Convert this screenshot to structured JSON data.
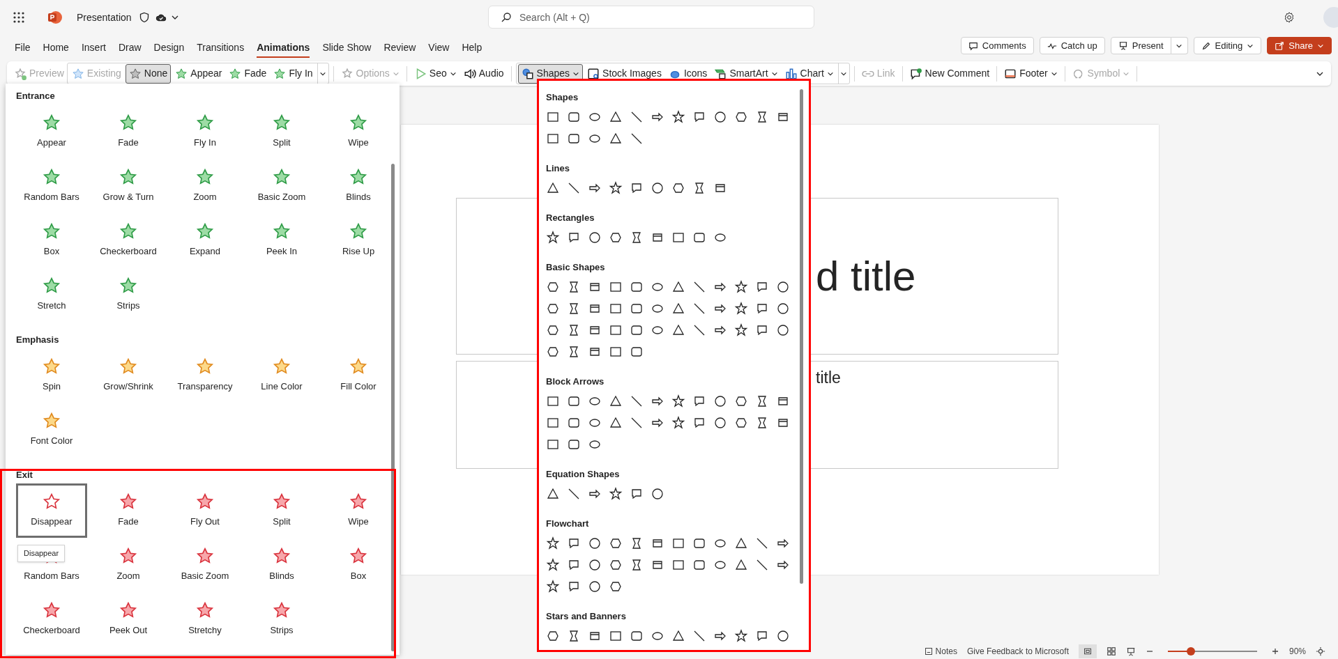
{
  "app": {
    "title": "Presentation"
  },
  "search": {
    "placeholder": "Search (Alt + Q)"
  },
  "menu_tabs": [
    {
      "label": "File",
      "selected": false
    },
    {
      "label": "Home",
      "selected": false
    },
    {
      "label": "Insert",
      "selected": false
    },
    {
      "label": "Draw",
      "selected": false
    },
    {
      "label": "Design",
      "selected": false
    },
    {
      "label": "Transitions",
      "selected": false
    },
    {
      "label": "Animations",
      "selected": true
    },
    {
      "label": "Slide Show",
      "selected": false
    },
    {
      "label": "Review",
      "selected": false
    },
    {
      "label": "View",
      "selected": false
    },
    {
      "label": "Help",
      "selected": false
    }
  ],
  "header_buttons": [
    {
      "label": "Comments",
      "kind": "comments"
    },
    {
      "label": "Catch up",
      "kind": "catchup"
    },
    {
      "label": "Present",
      "kind": "present"
    },
    {
      "label": "Editing",
      "kind": "editing"
    },
    {
      "label": "Share",
      "kind": "share"
    }
  ],
  "ribbon": [
    [
      {
        "label": "Preview",
        "disabled": true,
        "dropdown": false,
        "selected": false
      }
    ],
    [
      {
        "label": "Existing",
        "disabled": true,
        "dropdown": false,
        "selected": false
      },
      {
        "label": "None",
        "disabled": false,
        "dropdown": false,
        "selected": true
      },
      {
        "label": "Appear",
        "disabled": false,
        "dropdown": false,
        "selected": false
      },
      {
        "label": "Fade",
        "disabled": false,
        "dropdown": false,
        "selected": false
      },
      {
        "label": "Fly In",
        "disabled": false,
        "dropdown": false,
        "selected": false
      }
    ],
    [
      {
        "label": "Options",
        "disabled": true,
        "dropdown": true,
        "selected": false
      }
    ],
    [
      {
        "label": "Seo",
        "disabled": false,
        "dropdown": true,
        "selected": false
      },
      {
        "label": "Audio",
        "disabled": false,
        "dropdown": false,
        "selected": false
      }
    ],
    [
      {
        "label": "Shapes",
        "disabled": false,
        "dropdown": true,
        "selected": true
      },
      {
        "label": "Stock Images",
        "disabled": false,
        "dropdown": false,
        "selected": false
      },
      {
        "label": "Icons",
        "disabled": false,
        "dropdown": false,
        "selected": false
      },
      {
        "label": "SmartArt",
        "disabled": false,
        "dropdown": true,
        "selected": false
      },
      {
        "label": "Chart",
        "disabled": false,
        "dropdown": true,
        "selected": false
      }
    ],
    [
      {
        "label": "Link",
        "disabled": true,
        "dropdown": false,
        "selected": false
      }
    ],
    [
      {
        "label": "New Comment",
        "disabled": false,
        "dropdown": false,
        "selected": false
      }
    ],
    [
      {
        "label": "Footer",
        "disabled": false,
        "dropdown": true,
        "selected": false
      }
    ],
    [
      {
        "label": "Symbol",
        "disabled": true,
        "dropdown": true,
        "selected": false
      }
    ]
  ],
  "animation_panel": {
    "sections": [
      {
        "title": "Entrance",
        "kind": "entrance",
        "effects": [
          {
            "label": "Appear",
            "selected": false
          },
          {
            "label": "Fade",
            "selected": false
          },
          {
            "label": "Fly In",
            "selected": false
          },
          {
            "label": "Split",
            "selected": false
          },
          {
            "label": "Wipe",
            "selected": false
          },
          {
            "label": "Random Bars",
            "selected": false
          },
          {
            "label": "Grow & Turn",
            "selected": false
          },
          {
            "label": "Zoom",
            "selected": false
          },
          {
            "label": "Basic Zoom",
            "selected": false
          },
          {
            "label": "Blinds",
            "selected": false
          },
          {
            "label": "Box",
            "selected": false
          },
          {
            "label": "Checkerboard",
            "selected": false
          },
          {
            "label": "Expand",
            "selected": false
          },
          {
            "label": "Peek In",
            "selected": false
          },
          {
            "label": "Rise Up",
            "selected": false
          },
          {
            "label": "Stretch",
            "selected": false
          },
          {
            "label": "Strips",
            "selected": false
          }
        ]
      },
      {
        "title": "Emphasis",
        "kind": "emphasis",
        "effects": [
          {
            "label": "Spin",
            "selected": false
          },
          {
            "label": "Grow/Shrink",
            "selected": false
          },
          {
            "label": "Transparency",
            "selected": false
          },
          {
            "label": "Line Color",
            "selected": false
          },
          {
            "label": "Fill Color",
            "selected": false
          },
          {
            "label": "Font Color",
            "selected": false
          }
        ]
      },
      {
        "title": "Exit",
        "kind": "exit",
        "effects": [
          {
            "label": "Disappear",
            "selected": true
          },
          {
            "label": "Fade",
            "selected": false
          },
          {
            "label": "Fly Out",
            "selected": false
          },
          {
            "label": "Split",
            "selected": false
          },
          {
            "label": "Wipe",
            "selected": false
          },
          {
            "label": "Random Bars",
            "selected": false
          },
          {
            "label": "Zoom",
            "selected": false
          },
          {
            "label": "Basic Zoom",
            "selected": false
          },
          {
            "label": "Blinds",
            "selected": false
          },
          {
            "label": "Box",
            "selected": false
          },
          {
            "label": "Checkerboard",
            "selected": false
          },
          {
            "label": "Peek Out",
            "selected": false
          },
          {
            "label": "Stretchy",
            "selected": false
          },
          {
            "label": "Strips",
            "selected": false
          }
        ]
      }
    ],
    "tooltip": "Disappear"
  },
  "shapes_panel": {
    "sections": [
      {
        "title": "Shapes"
      },
      {
        "title": "Lines"
      },
      {
        "title": "Rectangles"
      },
      {
        "title": "Basic Shapes"
      },
      {
        "title": "Block Arrows"
      },
      {
        "title": "Equation Shapes"
      },
      {
        "title": "Flowchart"
      },
      {
        "title": "Stars and Banners"
      }
    ]
  },
  "slide": {
    "title": "d title",
    "subtitle": "title"
  },
  "status_bar": {
    "notes": "Notes",
    "feedback": "Give Feedback to Microsoft",
    "zoom_slider": {
      "level": 0.26
    },
    "zoom": "90%"
  }
}
